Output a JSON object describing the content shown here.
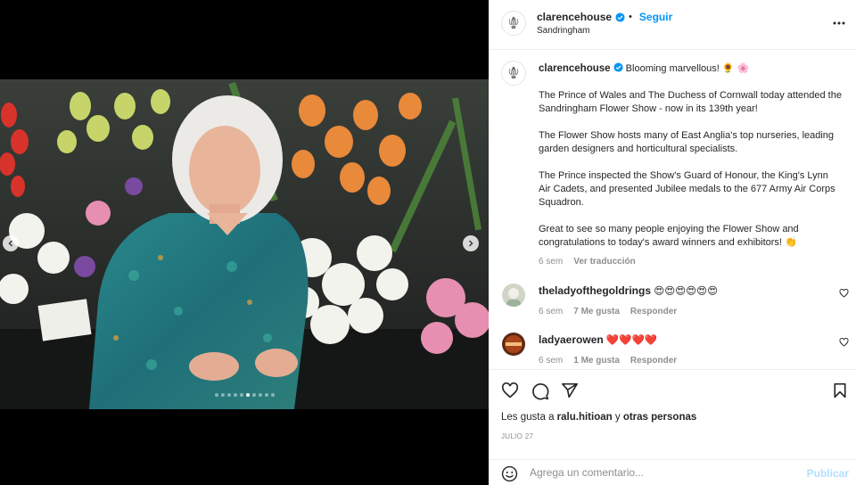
{
  "post": {
    "username": "clarencehouse",
    "follow_label": "Seguir",
    "location": "Sandringham",
    "more_icon": "more-horizontal-icon",
    "carousel": {
      "total": 10,
      "active_index": 5
    }
  },
  "caption": {
    "username": "clarencehouse",
    "headline": "Blooming marvellous! 🌻 🌸",
    "paragraphs": [
      "The Prince of Wales and The Duchess of Cornwall today attended the Sandringham Flower Show - now in its 139th year!",
      "The Flower Show hosts many of East Anglia's top nurseries, leading garden designers and horticultural specialists.",
      "The Prince inspected the Show's Guard of Honour, the King's Lynn Air Cadets, and presented Jubilee medals to the 677 Army Air Corps Squadron.",
      "Great to see so many people enjoying the Flower Show and congratulations to today's award winners and exhibitors! 👏"
    ],
    "time": "6 sem",
    "translate_label": "Ver traducción"
  },
  "comments": [
    {
      "username": "theladyofthegoldrings",
      "text": "😍😍😍😍😍😍",
      "time": "6 sem",
      "likes": "7 Me gusta",
      "reply": "Responder"
    },
    {
      "username": "ladyaerowen",
      "text": "❤️❤️❤️❤️",
      "time": "6 sem",
      "likes": "1 Me gusta",
      "reply": "Responder"
    }
  ],
  "likes": {
    "prefix": "Les gusta a",
    "user": "ralu.hitioan",
    "connector": "y",
    "others": "otras personas"
  },
  "date": "JULIO 27",
  "add_comment": {
    "placeholder": "Agrega un comentario...",
    "publish_label": "Publicar"
  },
  "colors": {
    "accent": "#0095f6",
    "publish_disabled": "#b2dffc",
    "heart_red": "#ed4956"
  }
}
